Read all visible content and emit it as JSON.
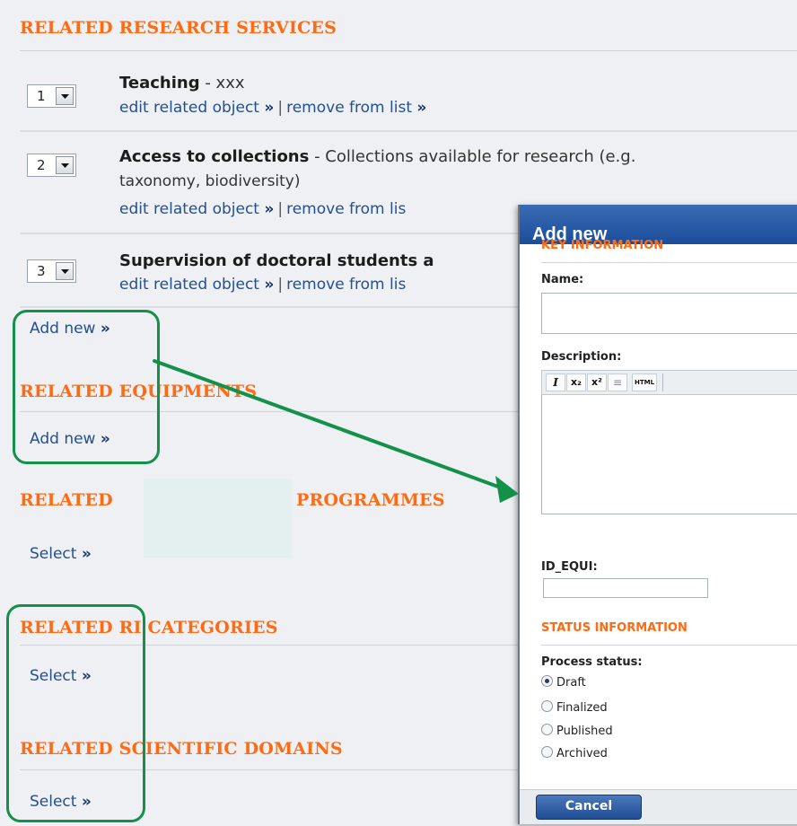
{
  "sections": {
    "research_services": "RELATED RESEARCH SERVICES",
    "equipments": "RELATED EQUIPMENTS",
    "programmes_prefix": "RELATED",
    "programmes_suffix": "PROGRAMMES",
    "ri_categories": "RELATED RI CATEGORIES",
    "scientific_domains": "RELATED SCIENTIFIC DOMAINS"
  },
  "research_services": [
    {
      "order": "1",
      "title": "Teaching",
      "desc": " - xxx",
      "desc2": ""
    },
    {
      "order": "2",
      "title": "Access to collections",
      "desc": " - Collections available for research (e.g.",
      "desc2": "taxonomy, biodiversity)"
    },
    {
      "order": "3",
      "title": "Supervision of doctoral students a",
      "desc": "",
      "desc2": ""
    }
  ],
  "links": {
    "edit": "edit related object",
    "remove": "remove from list",
    "remove_truncated": "remove from lis",
    "separator": "|",
    "raquo": "»",
    "add_new": "Add new",
    "select": "Select"
  },
  "dialog": {
    "title": "Add new",
    "key_info": "KEY INFORMATION",
    "name_label": "Name:",
    "name_value": "",
    "description_label": "Description:",
    "rte_buttons": [
      "I",
      "x₂",
      "x²",
      "≡",
      "HTML"
    ],
    "id_equi_label": "ID_EQUI:",
    "id_equi_value": "",
    "status_info": "STATUS INFORMATION",
    "process_status_label": "Process status:",
    "status_options": [
      "Draft",
      "Finalized",
      "Published",
      "Archived"
    ],
    "selected_status": "Draft",
    "cancel_label": "Cancel"
  },
  "colors": {
    "section_orange": "#ff6a13",
    "link_blue": "#23508f",
    "annotation_green": "#13914a",
    "dialog_header_blue": "#1b4d9b"
  }
}
